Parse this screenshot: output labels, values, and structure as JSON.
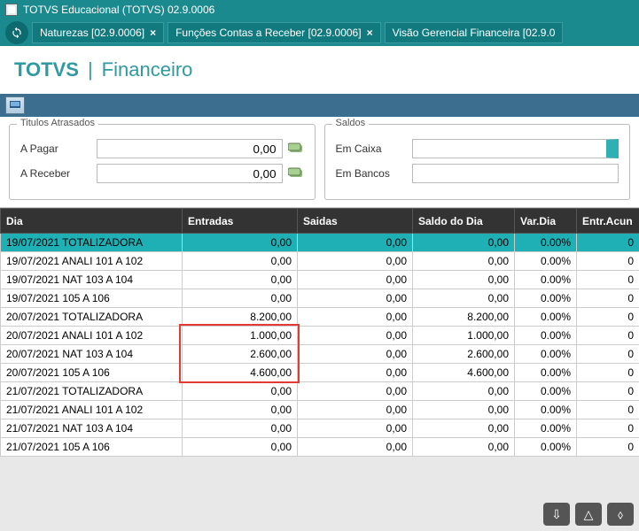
{
  "window": {
    "title": "TOTVS Educacional (TOTVS) 02.9.0006"
  },
  "tabs": [
    {
      "label": "Naturezas [02.9.0006]"
    },
    {
      "label": "Funções Contas a Receber [02.9.0006]"
    },
    {
      "label": "Visão Gerencial Financeira [02.9.0"
    }
  ],
  "header": {
    "brand": "TOTVS",
    "separator": "|",
    "module": "Financeiro"
  },
  "panels": {
    "atrasados": {
      "title": "Titulos Atrasados",
      "pagar_label": "A Pagar",
      "pagar_value": "0,00",
      "receber_label": "A Receber",
      "receber_value": "0,00"
    },
    "saldos": {
      "title": "Saldos",
      "caixa_label": "Em Caixa",
      "caixa_value": "",
      "bancos_label": "Em Bancos",
      "bancos_value": ""
    }
  },
  "columns": {
    "c0": "Dia",
    "c1": "Entradas",
    "c2": "Saidas",
    "c3": "Saldo do Dia",
    "c4": "Var.Dia",
    "c5": "Entr.Acun"
  },
  "rows": [
    {
      "dia": "19/07/2021 TOTALIZADORA",
      "ent": "0,00",
      "sai": "0,00",
      "saldo": "0,00",
      "var": "0.00%",
      "ea": "0",
      "hl": true
    },
    {
      "dia": "19/07/2021 ANALI 101 A 102",
      "ent": "0,00",
      "sai": "0,00",
      "saldo": "0,00",
      "var": "0.00%",
      "ea": "0"
    },
    {
      "dia": "19/07/2021 NAT 103 A 104",
      "ent": "0,00",
      "sai": "0,00",
      "saldo": "0,00",
      "var": "0.00%",
      "ea": "0"
    },
    {
      "dia": "19/07/2021 105 A 106",
      "ent": "0,00",
      "sai": "0,00",
      "saldo": "0,00",
      "var": "0.00%",
      "ea": "0"
    },
    {
      "dia": "20/07/2021 TOTALIZADORA",
      "ent": "8.200,00",
      "sai": "0,00",
      "saldo": "8.200,00",
      "var": "0.00%",
      "ea": "0"
    },
    {
      "dia": "20/07/2021 ANALI 101 A 102",
      "ent": "1.000,00",
      "sai": "0,00",
      "saldo": "1.000,00",
      "var": "0.00%",
      "ea": "0"
    },
    {
      "dia": "20/07/2021 NAT 103 A 104",
      "ent": "2.600,00",
      "sai": "0,00",
      "saldo": "2.600,00",
      "var": "0.00%",
      "ea": "0"
    },
    {
      "dia": "20/07/2021 105 A 106",
      "ent": "4.600,00",
      "sai": "0,00",
      "saldo": "4.600,00",
      "var": "0.00%",
      "ea": "0"
    },
    {
      "dia": "21/07/2021 TOTALIZADORA",
      "ent": "0,00",
      "sai": "0,00",
      "saldo": "0,00",
      "var": "0.00%",
      "ea": "0"
    },
    {
      "dia": "21/07/2021 ANALI 101 A 102",
      "ent": "0,00",
      "sai": "0,00",
      "saldo": "0,00",
      "var": "0.00%",
      "ea": "0"
    },
    {
      "dia": "21/07/2021 NAT 103 A 104",
      "ent": "0,00",
      "sai": "0,00",
      "saldo": "0,00",
      "var": "0.00%",
      "ea": "0"
    },
    {
      "dia": "21/07/2021 105 A 106",
      "ent": "0,00",
      "sai": "0,00",
      "saldo": "0,00",
      "var": "0.00%",
      "ea": "0"
    }
  ]
}
